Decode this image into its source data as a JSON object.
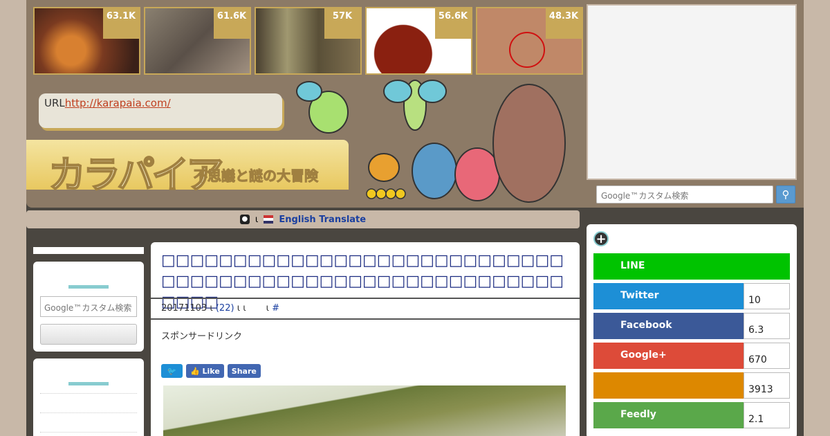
{
  "thumbnails": [
    {
      "count": "63.1K",
      "color_a": "#7a3a20",
      "color_b": "#d88030"
    },
    {
      "count": "61.6K",
      "color_a": "#6a6058",
      "color_b": "#a09080"
    },
    {
      "count": "57K",
      "color_a": "#5a5038",
      "color_b": "#a09870"
    },
    {
      "count": "56.6K",
      "color_a": "#8a2010",
      "color_b": "#d8a060"
    },
    {
      "count": "48.3K",
      "color_a": "#b07050",
      "color_b": "#d09878"
    }
  ],
  "header": {
    "url_label": "URL",
    "url_link": "http://karapaia.com/",
    "logo_text": "カラパイア",
    "tagline": "不思議と謎の大冒険"
  },
  "nav": {
    "separator": "ι",
    "translate_label": "English Translate"
  },
  "search": {
    "placeholder": "Google™カスタム検索",
    "button_icon": "search-icon"
  },
  "left_sidebar": {
    "search_placeholder": "Google™カスタム検索"
  },
  "article": {
    "title": "□□□□□□□□□□□□□□□□□□□□□□□□□□□□□□□□□□□□□□□□□□□□□□□□□□□□□□□□□□□□",
    "date": "20171103",
    "sep1": "ι",
    "comments": "(22)",
    "sep2": "ι ι",
    "sep3": "ι",
    "hash": "#",
    "sponsor_label": "スポンサードリンク",
    "share_like": "Like",
    "share_share": "Share"
  },
  "social": [
    {
      "label": "LINE",
      "count": "",
      "color": "#00c300"
    },
    {
      "label": "Twitter",
      "count": "10",
      "color": "#1d8fd6"
    },
    {
      "label": "Facebook",
      "count": "6.3",
      "color": "#3b5998"
    },
    {
      "label": "Google+",
      "count": "670",
      "color": "#dd4b39"
    },
    {
      "label": "",
      "count": "3913",
      "color": "#dd8800"
    },
    {
      "label": "Feedly",
      "count": "2.1",
      "color": "#5aa84a"
    }
  ]
}
